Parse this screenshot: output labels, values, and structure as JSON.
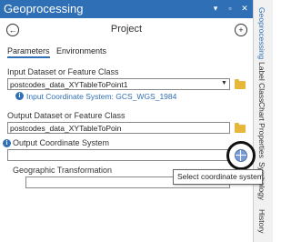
{
  "window": {
    "title": "Geoprocessing",
    "controls": {
      "pin": "▾",
      "restore": "▫",
      "close": "✕"
    }
  },
  "nav": {
    "back_icon": "←",
    "title": "Project",
    "add_icon": "+"
  },
  "tabs": {
    "parameters": "Parameters",
    "environments": "Environments"
  },
  "fields": {
    "input_label": "Input Dataset or Feature Class",
    "input_value": "postcodes_data_XYTableToPoint1",
    "input_coord": "Input Coordinate System: GCS_WGS_1984",
    "output_label": "Output Dataset or Feature Class",
    "output_value": "postcodes_data_XYTableToPoin",
    "output_coord_label": "Output Coordinate System",
    "output_coord_value": "",
    "geo_transform_label": "Geographic Transformation",
    "geo_transform_value": ""
  },
  "tooltip": "Select coordinate system",
  "sidebar": {
    "tabs": [
      "Geoprocessing",
      "Label Class",
      "Chart Properties",
      "Symbology",
      "History"
    ]
  },
  "colors": {
    "accent": "#2f6fb6",
    "folder": "#e7b73a"
  }
}
